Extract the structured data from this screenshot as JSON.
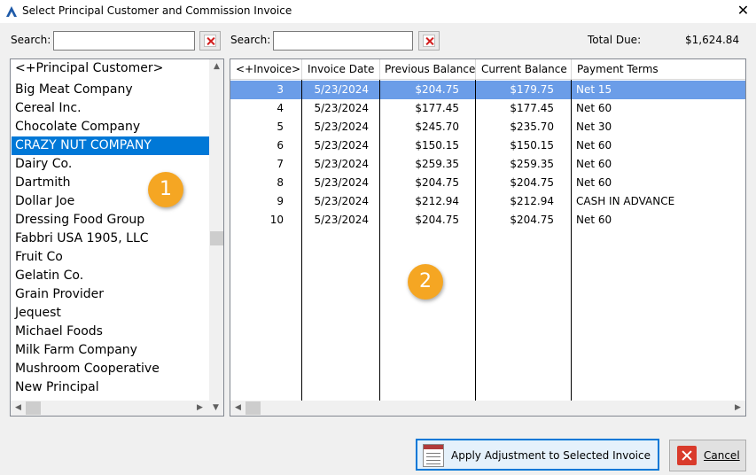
{
  "window": {
    "title": "Select Principal Customer and Commission Invoice"
  },
  "left_search": {
    "label": "Search:",
    "value": "",
    "placeholder": ""
  },
  "right_search": {
    "label": "Search:",
    "value": "",
    "placeholder": ""
  },
  "total_due": {
    "label": "Total Due:",
    "value": "$1,624.84"
  },
  "customers": {
    "header": "<+Principal Customer>",
    "items": [
      "Big Meat Company",
      "Cereal Inc.",
      "Chocolate Company",
      "CRAZY NUT COMPANY",
      "Dairy Co.",
      "Dartmith",
      "Dollar Joe",
      "Dressing Food Group",
      "Fabbri USA 1905, LLC",
      "Fruit Co",
      "Gelatin Co.",
      "Grain Provider",
      "Jequest",
      "Michael Foods",
      "Milk Farm Company",
      "Mushroom Cooperative",
      "New Principal"
    ],
    "selected": "CRAZY NUT COMPANY"
  },
  "invoices": {
    "columns": [
      "<+Invoice>",
      "Invoice Date",
      "Previous Balance",
      "Current Balance",
      "Payment Terms"
    ],
    "rows": [
      [
        "3",
        "5/23/2024",
        "$204.75",
        "$179.75",
        "Net 15"
      ],
      [
        "4",
        "5/23/2024",
        "$177.45",
        "$177.45",
        "Net 60"
      ],
      [
        "5",
        "5/23/2024",
        "$245.70",
        "$235.70",
        "Net 30"
      ],
      [
        "6",
        "5/23/2024",
        "$150.15",
        "$150.15",
        "Net 60"
      ],
      [
        "7",
        "5/23/2024",
        "$259.35",
        "$259.35",
        "Net 60"
      ],
      [
        "8",
        "5/23/2024",
        "$204.75",
        "$204.75",
        "Net 60"
      ],
      [
        "9",
        "5/23/2024",
        "$212.94",
        "$212.94",
        "CASH IN ADVANCE"
      ],
      [
        "10",
        "5/23/2024",
        "$204.75",
        "$204.75",
        "Net 60"
      ]
    ],
    "selected_row": 0
  },
  "badges": {
    "one": "1",
    "two": "2"
  },
  "buttons": {
    "apply": "Apply Adjustment to Selected Invoice",
    "cancel": "Cancel"
  },
  "colors": {
    "selection_blue": "#0078d7",
    "row_selection": "#6b9de8",
    "badge_orange": "#f5a623",
    "clear_red": "#d21f1f"
  },
  "icons": {
    "app": "app-logo-icon",
    "close": "close-icon",
    "clear": "clear-x-icon",
    "apply": "document-icon",
    "cancel": "cancel-icon"
  }
}
